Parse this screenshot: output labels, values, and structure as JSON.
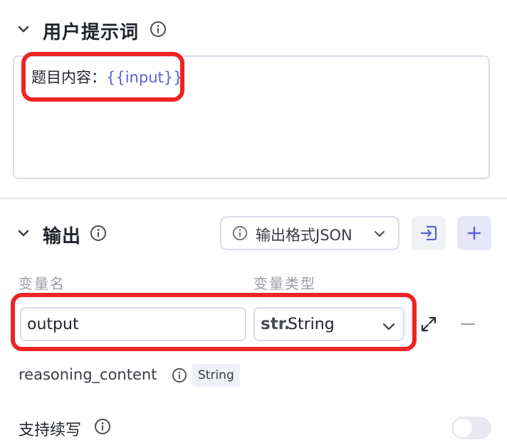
{
  "prompt_section": {
    "title": "用户提示词",
    "content_prefix": "题目内容：",
    "content_variable": "{{input}}"
  },
  "output_section": {
    "title": "输出",
    "format_button": "输出格式JSON",
    "columns": {
      "var_name": "变量名",
      "var_type": "变量类型"
    },
    "rows": [
      {
        "name": "output",
        "type_prefix": "str.",
        "type": "String"
      }
    ],
    "reasoning": {
      "label": "reasoning_content",
      "type_tag": "String"
    },
    "streaming": {
      "label": "支持续写",
      "enabled": false
    }
  },
  "colors": {
    "accent": "#5b5fd6",
    "highlight_border": "#ee2424",
    "button_bg": "#ebebfb"
  }
}
